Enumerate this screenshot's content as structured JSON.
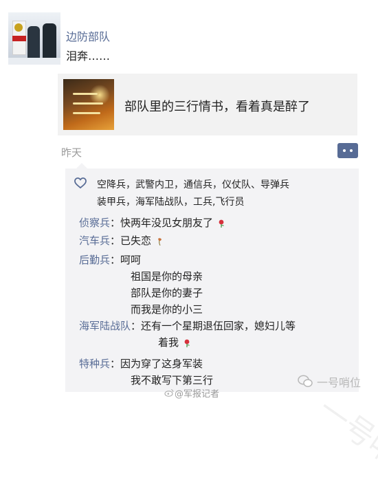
{
  "moment": {
    "poster_name": "边防部队",
    "text": "泪奔……",
    "shared_link": {
      "title": "部队里的三行情书，看着真是醉了"
    },
    "timestamp": "昨天"
  },
  "likes": {
    "line1": "空降兵，武警内卫，通信兵，仪仗队、导弹兵",
    "line2": "装甲兵，海军陆战队，工兵,飞行员"
  },
  "comments": [
    {
      "author": "侦察兵",
      "separator": "：",
      "lines": [
        "快两年没见女朋友了"
      ],
      "emoji": "rose"
    },
    {
      "author": "汽车兵",
      "separator": "：",
      "lines": [
        "已失恋"
      ],
      "emoji": "wilted-rose"
    },
    {
      "author": "后勤兵",
      "separator": "：",
      "lines": [
        "呵呵",
        "祖国是你的母亲",
        "部队是你的妻子",
        "而我是你的小三"
      ]
    },
    {
      "author": "海军陆战队",
      "separator": "：",
      "lines": [
        "还有一个星期退伍回家，媳妇儿等",
        "着我"
      ],
      "emoji": "rose"
    },
    {
      "author": "特种兵",
      "separator": "：",
      "lines": [
        "因为穿了这身军装",
        "我不敢写下第三行"
      ]
    }
  ],
  "watermarks": {
    "account": "一号哨位",
    "credit": "@军报记者",
    "diagonal": "一号哨位"
  },
  "colors": {
    "name_blue": "#576b95",
    "card_bg": "#f2f2f2",
    "comment_bg": "#f3f3f5"
  }
}
